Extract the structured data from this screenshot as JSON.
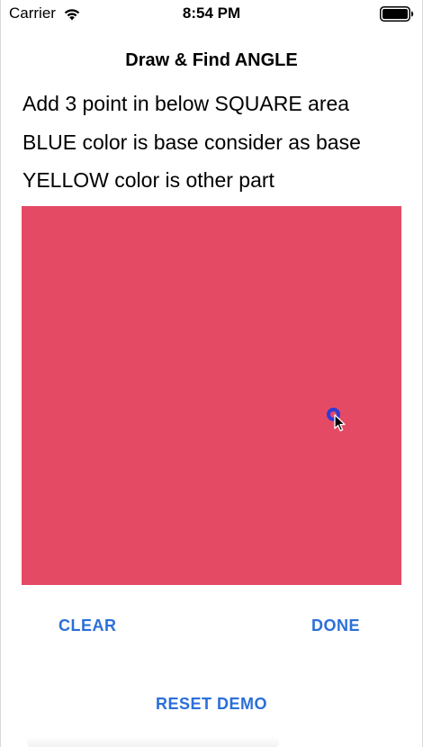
{
  "status_bar": {
    "carrier": "Carrier",
    "time": "8:54 PM",
    "wifi_icon": "wifi-icon",
    "battery_icon": "battery-icon"
  },
  "nav": {
    "title": "Draw & Find ANGLE"
  },
  "instructions": {
    "line1": "Add 3 point in below SQUARE area",
    "line2": "BLUE color is base consider as base",
    "line3": "YELLOW color is other part"
  },
  "canvas": {
    "background_color": "#e44a64",
    "point_color": "#2f3bd8",
    "points_drawn": 1,
    "cursor_icon": "arrow-cursor-icon"
  },
  "buttons": {
    "clear_label": "CLEAR",
    "done_label": "DONE",
    "reset_label": "RESET DEMO",
    "accent_color": "#2b6fd8"
  }
}
